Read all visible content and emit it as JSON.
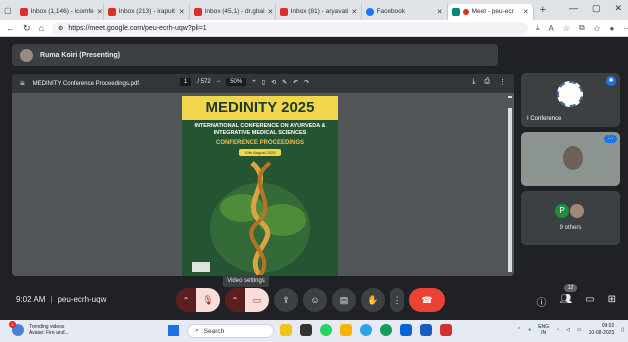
{
  "browser": {
    "tabs": [
      {
        "label": "Inbox (1,146) - icomfe",
        "icon": "gmail-icon",
        "color": "#d93025"
      },
      {
        "label": "Inbox (213) - irapult",
        "icon": "gmail-icon",
        "color": "#d93025"
      },
      {
        "label": "Inbox (45,1) - dr.gbai",
        "icon": "gmail-icon",
        "color": "#d93025"
      },
      {
        "label": "Inbox (81) - aryavati",
        "icon": "gmail-icon",
        "color": "#d93025"
      },
      {
        "label": "Facebook",
        "icon": "facebook-icon",
        "color": "#1877f2"
      },
      {
        "label": "Meet - peu-ecr",
        "icon": "meet-icon",
        "color": "#00897b"
      }
    ],
    "url": "https://meet.google.com/peu-ecrh-uqw?pli=1"
  },
  "meet": {
    "presenter": "Ruma Koiri (Presenting)",
    "pdf": {
      "filename": "MEDINITY Conference Proceedings.pdf",
      "page": "1",
      "page_total": "/ 572",
      "zoom": "50%"
    },
    "cover": {
      "title": "MEDINITY 2025",
      "conference": "INTERNATIONAL CONFERENCE ON AYURVEDA & INTEGRATIVE MEDICAL SCIENCES",
      "proceedings": "CONFERENCE PROCEEDINGS",
      "date": "10th August 2025"
    },
    "tiles": {
      "tile1_name": "I Conference",
      "tile3_initial": "P",
      "others": "9 others"
    },
    "tooltip": "Video settings",
    "time": "9:02 AM",
    "meeting_code": "peu-ecrh-uqw",
    "participants_count": "12"
  },
  "taskbar": {
    "weather_title": "Trending videos",
    "weather_sub": "Avatar: Fire and...",
    "notification_count": "2",
    "search_placeholder": "Search",
    "lang_top": "ENG",
    "lang_bottom": "IN",
    "clock_time": "09:02",
    "clock_date": "10-08-2025"
  }
}
